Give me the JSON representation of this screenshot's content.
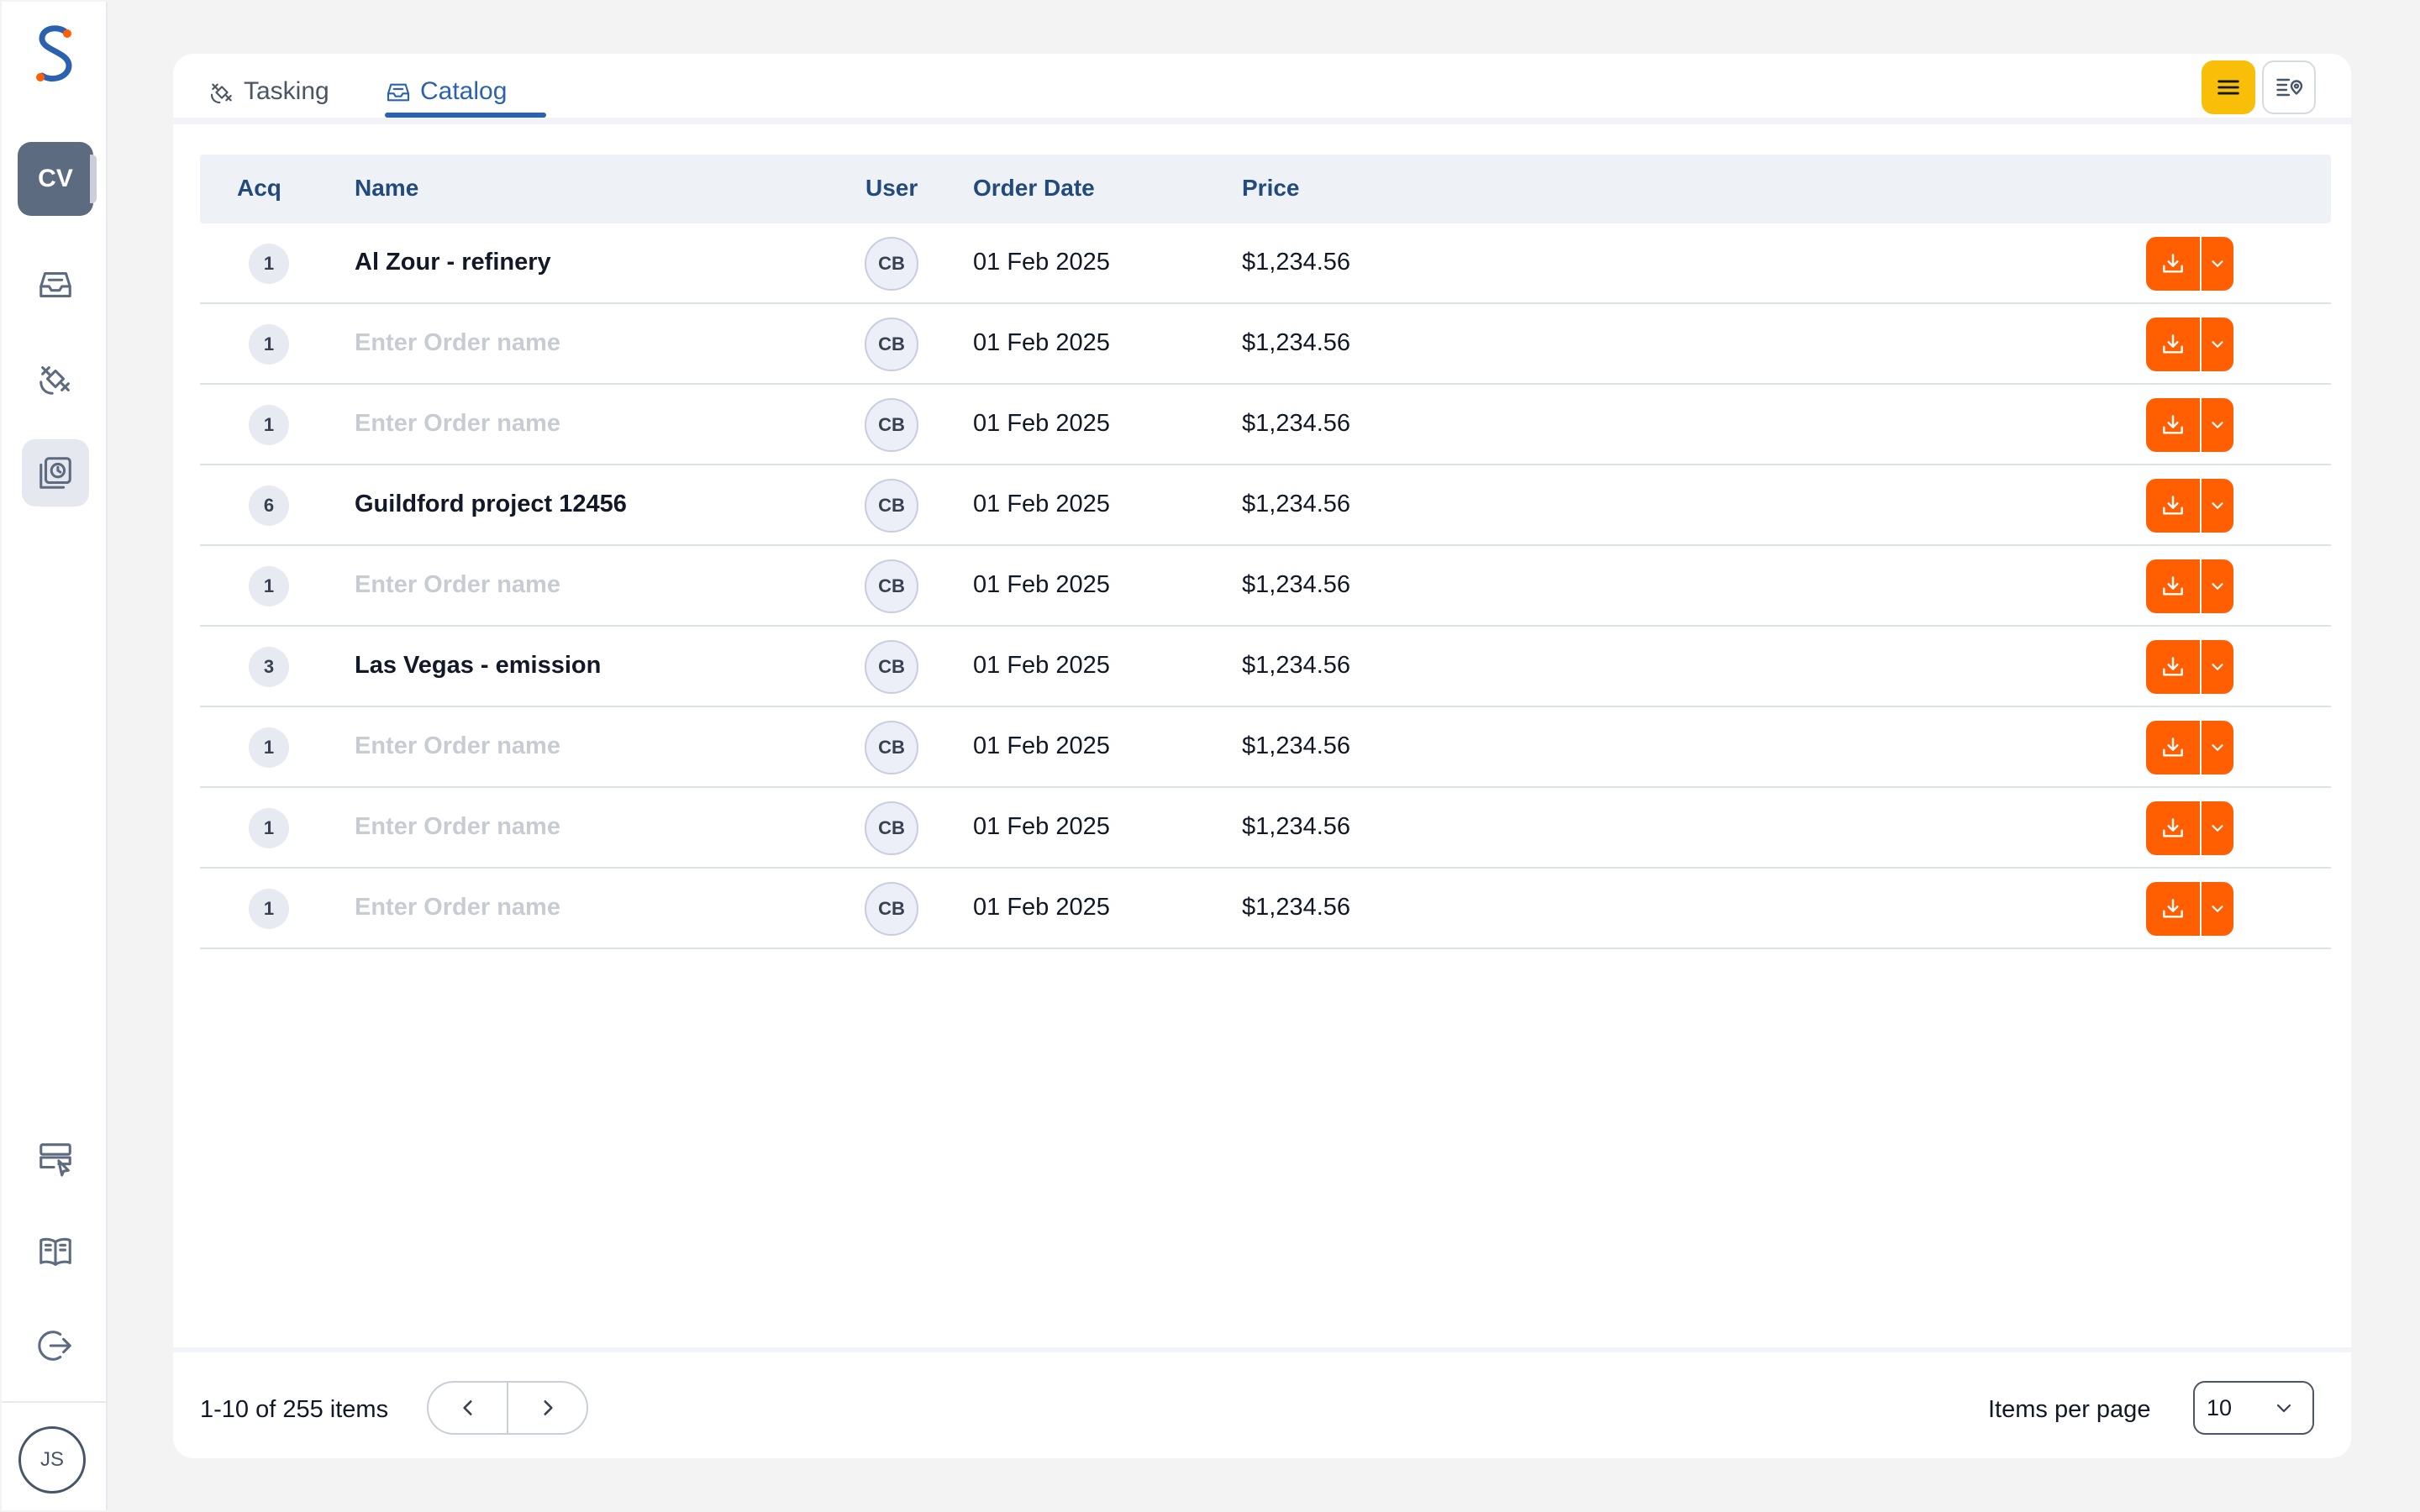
{
  "sidebar": {
    "workspace_badge": "CV",
    "user_initials": "JS",
    "items": [
      {
        "name": "inbox-icon"
      },
      {
        "name": "satellite-icon"
      },
      {
        "name": "orders-history-icon"
      },
      {
        "name": "server-select-icon"
      },
      {
        "name": "book-icon"
      },
      {
        "name": "logout-icon"
      }
    ]
  },
  "tabs": [
    {
      "label": "Tasking",
      "icon": "satellite-icon"
    },
    {
      "label": "Catalog",
      "icon": "inbox-icon"
    }
  ],
  "view_toggle": {
    "list": "list-icon",
    "map": "map-list-icon"
  },
  "table": {
    "headers": {
      "acq": "Acq",
      "name": "Name",
      "user": "User",
      "order_date": "Order Date",
      "price": "Price"
    },
    "rows": [
      {
        "acq": "1",
        "name": "Al Zour - refinery",
        "placeholder": false,
        "user": "CB",
        "date": "01 Feb 2025",
        "price": "$1,234.56"
      },
      {
        "acq": "1",
        "name": "Enter Order name",
        "placeholder": true,
        "user": "CB",
        "date": "01 Feb 2025",
        "price": "$1,234.56"
      },
      {
        "acq": "1",
        "name": "Enter Order name",
        "placeholder": true,
        "user": "CB",
        "date": "01 Feb 2025",
        "price": "$1,234.56"
      },
      {
        "acq": "6",
        "name": "Guildford project 12456",
        "placeholder": false,
        "user": "CB",
        "date": "01 Feb 2025",
        "price": "$1,234.56"
      },
      {
        "acq": "1",
        "name": "Enter Order name",
        "placeholder": true,
        "user": "CB",
        "date": "01 Feb 2025",
        "price": "$1,234.56"
      },
      {
        "acq": "3",
        "name": "Las Vegas - emission",
        "placeholder": false,
        "user": "CB",
        "date": "01 Feb 2025",
        "price": "$1,234.56"
      },
      {
        "acq": "1",
        "name": "Enter Order name",
        "placeholder": true,
        "user": "CB",
        "date": "01 Feb 2025",
        "price": "$1,234.56"
      },
      {
        "acq": "1",
        "name": "Enter Order name",
        "placeholder": true,
        "user": "CB",
        "date": "01 Feb 2025",
        "price": "$1,234.56"
      },
      {
        "acq": "1",
        "name": "Enter Order name",
        "placeholder": true,
        "user": "CB",
        "date": "01 Feb 2025",
        "price": "$1,234.56"
      }
    ]
  },
  "footer": {
    "items_count": "1-10 of 255 items",
    "items_per_page_label": "Items per page",
    "items_per_page_value": "10"
  },
  "colors": {
    "accent": "#2b62b0",
    "download": "#ff5f00",
    "active_view": "#f8be08"
  }
}
